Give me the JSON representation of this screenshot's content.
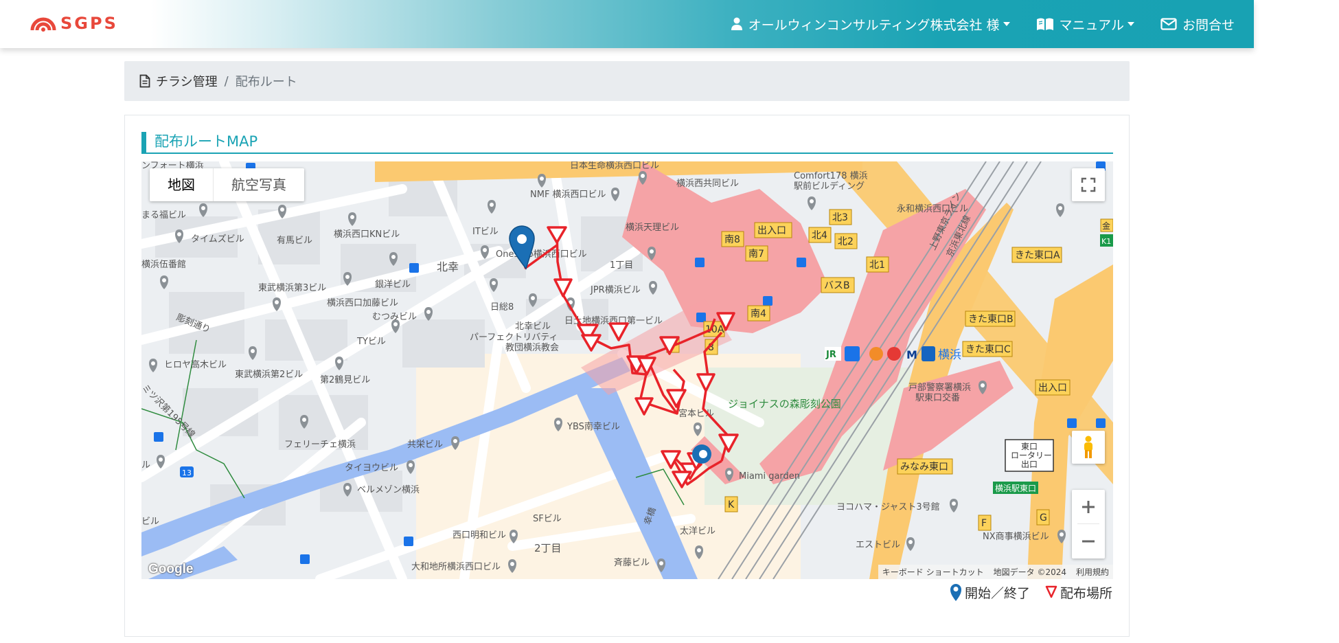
{
  "header": {
    "logo_text": "SGPS",
    "user_label": "オールウィンコンサルティング株式会社 様",
    "manual_label": "マニュアル",
    "contact_label": "お問合せ"
  },
  "breadcrumb": {
    "parent": "チラシ管理",
    "separator": "/",
    "current": "配布ルート"
  },
  "section": {
    "title": "配布ルートMAP"
  },
  "map": {
    "type_buttons": [
      "地図",
      "航空写真"
    ],
    "google_logo": "Google",
    "attribution": [
      "キーボード ショートカット",
      "地図データ ©2024",
      "利用規約"
    ],
    "labels": [
      "日本生命横浜西口ビル",
      "横浜西共同ビル",
      "Comfort178 横浜",
      "駅前ビルディング",
      "永和横浜西口ビル",
      "NMF 横浜西口ビル",
      "ITビル",
      "横浜天理ビル",
      "横浜西口KNビル",
      "有馬ビル",
      "タイムズビル",
      "Onestep横浜西口ビル",
      "1丁目",
      "北幸",
      "JPR横浜ビル",
      "銀洋ビル",
      "東武横浜第3ビル",
      "日総8",
      "横浜西口加藤ビル",
      "むつみビル",
      "北幸ビル",
      "日土地横浜西口第一ビル",
      "パーフェクトリバティ",
      "教団横浜教会",
      "TYビル",
      "ヒロヤ高木ビル",
      "東武横浜第2ビル",
      "第2鶴見ビル",
      "ジョイナスの森彫刻公園",
      "宮本ビル",
      "YBS南幸ビル",
      "フェリーチェ横浜",
      "共栄ビル",
      "タイヨウビル",
      "ベルメゾン横浜",
      "Miami garden",
      "戸部警察署横浜",
      "駅東口交番",
      "横浜",
      "ヨコハマ・ジャスト3号館",
      "SFビル",
      "西口明和ビル",
      "2丁目",
      "太洋ビル",
      "大和地所横浜西口ビル",
      "斉藤ビル",
      "エストビル",
      "NX商事横浜ビル",
      "彫刻通り",
      "ミツ沢第195号線",
      "幸橋",
      "まる福ビル",
      "横浜伍番館",
      "ンフォート横浜",
      "上野東京ライン",
      "京浜東北線"
    ],
    "station_tags": [
      "南8",
      "出入口",
      "北3",
      "北4",
      "北2",
      "北1",
      "南7",
      "バスB",
      "南4",
      "10A",
      "9",
      "8",
      "きた東口A",
      "きた東口B",
      "きた東口C",
      "出入口",
      "みなみ東口",
      "K",
      "F",
      "G",
      "横浜駅東口",
      "13",
      "K1",
      "金"
    ],
    "exit_box": [
      "東口",
      "ロータリー",
      "出口"
    ],
    "route_color": "#e8232a",
    "marker_color": "#1b6fb5"
  },
  "legend": {
    "start_end": "開始／終了",
    "drop_point": "配布場所"
  },
  "colors": {
    "brand": "#1aa3b4",
    "logo": "#e8483b",
    "station_pink": "#f5a3a6",
    "water": "#9bbcf4",
    "highway": "#fbc970"
  }
}
